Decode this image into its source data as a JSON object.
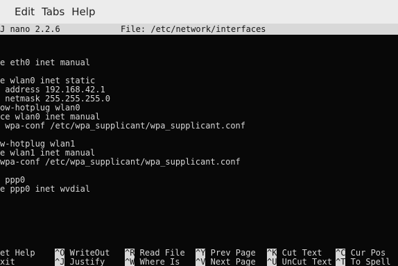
{
  "menubar": {
    "items": [
      "Edit",
      "Tabs",
      "Help"
    ]
  },
  "nano": {
    "version": "J nano 2.2.6",
    "file": "File: /etc/network/interfaces"
  },
  "editor": {
    "lines": [
      "",
      "",
      "e eth0 inet manual",
      "",
      "e wlan0 inet static",
      " address 192.168.42.1",
      " netmask 255.255.255.0",
      "ow-hotplug wlan0",
      "ce wlan0 inet manual",
      " wpa-conf /etc/wpa_supplicant/wpa_supplicant.conf",
      "",
      "w-hotplug wlan1",
      "e wlan1 inet manual",
      "wpa-conf /etc/wpa_supplicant/wpa_supplicant.conf",
      "",
      " ppp0",
      "e ppp0 inet wvdial"
    ]
  },
  "shortcuts": {
    "row1": [
      {
        "key": "",
        "label": "et Help"
      },
      {
        "key": "^O",
        "label": " WriteOut"
      },
      {
        "key": "^R",
        "label": " Read File"
      },
      {
        "key": "^Y",
        "label": " Prev Page"
      },
      {
        "key": "^K",
        "label": " Cut Text"
      },
      {
        "key": "^C",
        "label": " Cur Pos"
      }
    ],
    "row2": [
      {
        "key": "",
        "label": "xit"
      },
      {
        "key": "^J",
        "label": " Justify"
      },
      {
        "key": "^W",
        "label": " Where Is"
      },
      {
        "key": "^V",
        "label": " Next Page"
      },
      {
        "key": "^U",
        "label": " UnCut Text"
      },
      {
        "key": "^T",
        "label": " To Spell"
      }
    ]
  }
}
